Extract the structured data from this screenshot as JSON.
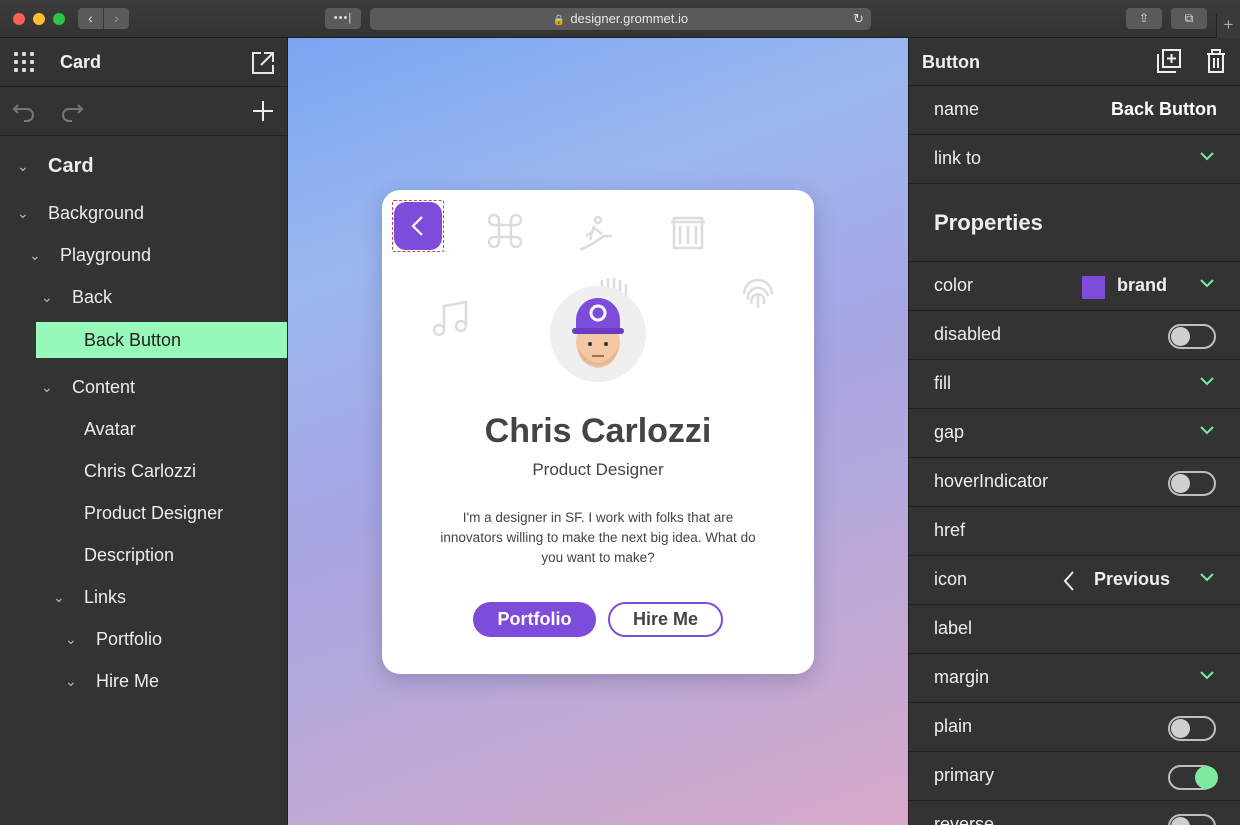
{
  "browser": {
    "url": "designer.grommet.io"
  },
  "left_panel": {
    "title": "Card",
    "tree": [
      {
        "label": "Card"
      },
      {
        "label": "Background"
      },
      {
        "label": "Playground"
      },
      {
        "label": "Back"
      },
      {
        "label": "Back Button"
      },
      {
        "label": "Content"
      },
      {
        "label": "Avatar"
      },
      {
        "label": "Chris Carlozzi"
      },
      {
        "label": "Product Designer"
      },
      {
        "label": "Description"
      },
      {
        "label": "Links"
      },
      {
        "label": "Portfolio"
      },
      {
        "label": "Hire Me"
      }
    ]
  },
  "card": {
    "name": "Chris Carlozzi",
    "role": "Product Designer",
    "description": "I'm a designer in SF. I work with folks that are innovators willing to make the next big idea. What do you want to make?",
    "button_primary": "Portfolio",
    "button_secondary": "Hire Me",
    "accent_color": "#7d4cdb"
  },
  "right_panel": {
    "title": "Button",
    "name_label": "name",
    "name_value": "Back Button",
    "link_label": "link to",
    "section_title": "Properties",
    "props": [
      {
        "label": "color",
        "value": "brand"
      },
      {
        "label": "disabled",
        "value": false
      },
      {
        "label": "fill"
      },
      {
        "label": "gap"
      },
      {
        "label": "hoverIndicator",
        "value": false
      },
      {
        "label": "href"
      },
      {
        "label": "icon",
        "value": "Previous"
      },
      {
        "label": "label"
      },
      {
        "label": "margin"
      },
      {
        "label": "plain",
        "value": false
      },
      {
        "label": "primary",
        "value": true
      },
      {
        "label": "reverse",
        "value": false
      }
    ],
    "selection_color": "#97f9b9"
  }
}
